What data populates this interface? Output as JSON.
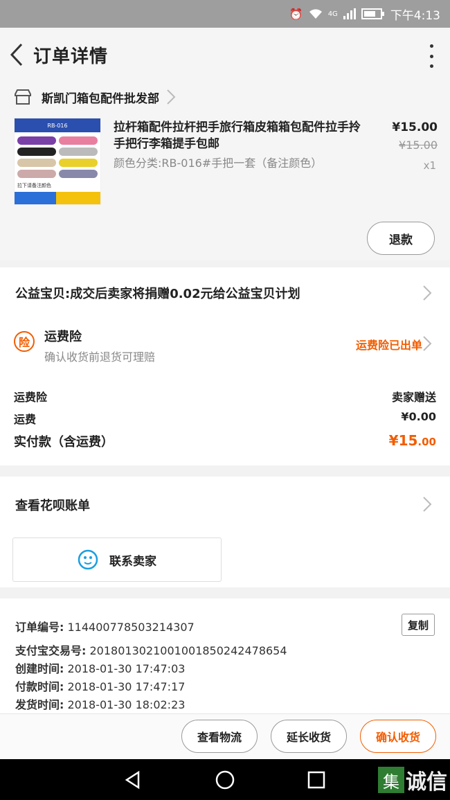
{
  "status_bar": {
    "time": "下午4:13",
    "network": "4G"
  },
  "header": {
    "title": "订单详情"
  },
  "shop": {
    "name": "斯凯门箱包配件批发部"
  },
  "product": {
    "title": "拉杆箱配件拉杆把手旅行箱皮箱箱包配件拉手拎手把行李箱提手包邮",
    "spec": "颜色分类:RB-016#手把一套（备注颜色）",
    "price": "¥15.00",
    "original_price": "¥15.00",
    "quantity": "x1",
    "thumb_label": "RB-016",
    "thumb_note": "拉下请备注颜色",
    "refund_label": "退款"
  },
  "charity": {
    "text": "公益宝贝:成交后卖家将捐赠0.02元给公益宝贝计划"
  },
  "insurance": {
    "icon_char": "险",
    "title": "运费险",
    "subtitle": "确认收货前退货可理赔",
    "status": "运费险已出单"
  },
  "fees": {
    "insurance_label": "运费险",
    "insurance_value": "卖家赠送",
    "shipping_label": "运费",
    "shipping_value": "¥0.00",
    "total_label": "实付款（含运费）",
    "total_currency": "¥",
    "total_int": "15",
    "total_dec": ".00"
  },
  "huabei": {
    "label": "查看花呗账单",
    "contact_label": "联系卖家"
  },
  "order_info": {
    "order_no_label": "订单编号:",
    "order_no": "114400778503214307",
    "copy_label": "复制",
    "alipay_label": "支付宝交易号:",
    "alipay_no": "2018013021001001850242478654",
    "created_label": "创建时间:",
    "created": "2018-01-30 17:47:03",
    "paid_label": "付款时间:",
    "paid": "2018-01-30 17:47:17",
    "shipped_label": "发货时间:",
    "shipped": "2018-01-30 18:02:23"
  },
  "actions": {
    "logistics": "查看物流",
    "extend": "延长收货",
    "confirm": "确认收货"
  },
  "watermark": {
    "box_char": "集",
    "text": "诚信"
  },
  "colors": {
    "accent": "#f25d00",
    "status_bar": "#9e9e9e"
  }
}
